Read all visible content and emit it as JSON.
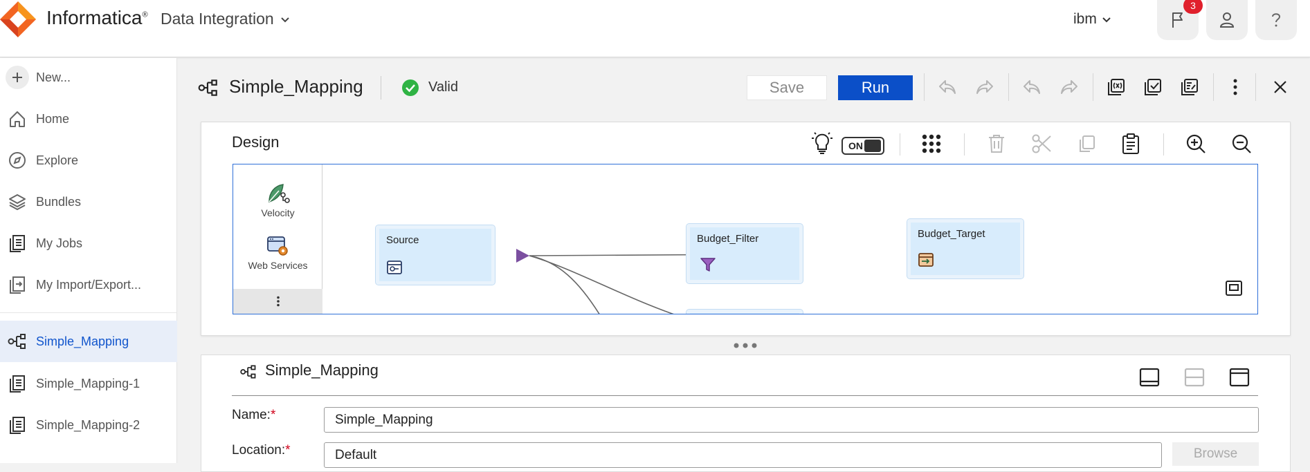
{
  "header": {
    "brand": "Informatica",
    "brand_mark": "®",
    "app_name": "Data Integration",
    "org": "ibm",
    "notifications_count": "3",
    "icons": [
      "informatica-logo",
      "chevron-down-icon",
      "flag-icon",
      "user-icon",
      "help-icon"
    ]
  },
  "sidebar": {
    "new_label": "New...",
    "items": [
      {
        "label": "Home",
        "icon": "home-icon"
      },
      {
        "label": "Explore",
        "icon": "compass-icon"
      },
      {
        "label": "Bundles",
        "icon": "layers-icon"
      },
      {
        "label": "My Jobs",
        "icon": "jobs-icon"
      },
      {
        "label": "My Import/Export..."
      }
    ],
    "open_tabs": [
      {
        "label": "Simple_Mapping",
        "active": true
      },
      {
        "label": "Simple_Mapping-1"
      },
      {
        "label": "Simple_Mapping-2"
      }
    ]
  },
  "mapping": {
    "title": "Simple_Mapping",
    "status": "Valid",
    "save_label": "Save",
    "run_label": "Run"
  },
  "design": {
    "label": "Design",
    "toggle_label": "ON",
    "palette": [
      {
        "label": "Velocity"
      },
      {
        "label": "Web Services"
      }
    ],
    "nodes": [
      {
        "label": "Source"
      },
      {
        "label": "Budget_Filter"
      },
      {
        "label": "Budget_Target"
      }
    ]
  },
  "properties": {
    "title": "Simple_Mapping",
    "name_label": "Name:",
    "name_value": "Simple_Mapping",
    "location_label": "Location:",
    "location_value": "Default",
    "browse_label": "Browse",
    "required_mark": "*"
  },
  "colors": {
    "brand_orange": "#f26522",
    "run_blue": "#0b4fc8",
    "active_text": "#1155cc",
    "node_fill": "#d8ecfc",
    "port_purple": "#7b4fa0",
    "valid_green": "#2fb344",
    "badge_red": "#e0202c"
  }
}
